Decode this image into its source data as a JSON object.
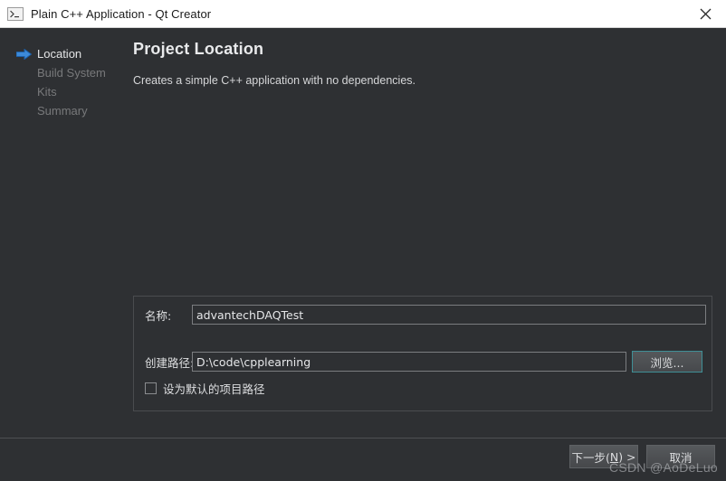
{
  "window": {
    "title": "Plain C++ Application - Qt Creator",
    "icon": "console-app-icon",
    "close_label": "✕",
    "titlebar_bg": "#ffffff",
    "body_bg": "#2e3033"
  },
  "sidebar": {
    "current_marker_icon": "blue-right-arrow-icon",
    "items": [
      {
        "label": "Location",
        "state": "current"
      },
      {
        "label": "Build System",
        "state": "upcoming"
      },
      {
        "label": "Kits",
        "state": "upcoming"
      },
      {
        "label": "Summary",
        "state": "upcoming"
      }
    ]
  },
  "main": {
    "heading": "Project Location",
    "description": "Creates a simple C++ application with no dependencies."
  },
  "form": {
    "name_label": "名称:",
    "name_value": "advantechDAQTest",
    "name_placeholder": "",
    "path_label": "创建路径:",
    "path_value": "D:\\code\\cpplearning",
    "path_placeholder": "",
    "browse_label": "浏览...",
    "default_path_checkbox_label": "设为默认的项目路径",
    "default_path_checked": false,
    "browse_focus_color": "#3f8f96"
  },
  "footer": {
    "next_prefix": "下一步(",
    "next_mnemonic": "N",
    "next_suffix": ") >",
    "cancel_label": "取消"
  },
  "watermark": {
    "text": "CSDN @AoDeLuo"
  }
}
